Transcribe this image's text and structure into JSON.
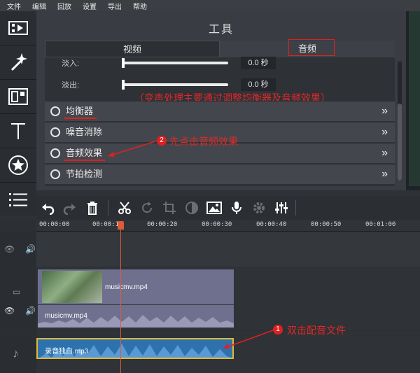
{
  "menu": [
    "文件",
    "编辑",
    "回放",
    "设置",
    "导出",
    "帮助"
  ],
  "sidebar": [
    "film-icon",
    "magic-wand-icon",
    "clip-icon",
    "text-icon",
    "star-icon",
    "list-icon"
  ],
  "panel": {
    "title": "工具",
    "tabs": {
      "video": "视频",
      "audio": "音频"
    },
    "fade_in": {
      "label": "淡入:",
      "value": "0.0 秒"
    },
    "fade_out": {
      "label": "淡出:",
      "value": "0.0 秒"
    },
    "annotation_main": "（变声处理主要通过调整均衡器及音频效果）",
    "effects": [
      {
        "label": "均衡器"
      },
      {
        "label": "噪音消除"
      },
      {
        "label": "音频效果"
      },
      {
        "label": "节拍检测"
      }
    ],
    "annotation_step2": "先点击音频效果",
    "step2_number": "2"
  },
  "toolbar": [
    "undo-icon",
    "redo-icon",
    "delete-icon",
    "cut-icon",
    "rotate-icon",
    "crop-icon",
    "color-icon",
    "image-icon",
    "mic-icon",
    "settings-icon",
    "equalizer-icon"
  ],
  "timeline": {
    "ticks": [
      "00:00:00",
      "00:00:10",
      "00:00:20",
      "00:00:30",
      "00:00:40",
      "00:00:50",
      "00:01:00"
    ],
    "video_clip_name": "musicmv.mp4",
    "audio_clip_name": "musicmv.mp4",
    "voice_clip_name": "录音独白.mp3",
    "annotation_step1": "双击配音文件",
    "step1_number": "1"
  }
}
